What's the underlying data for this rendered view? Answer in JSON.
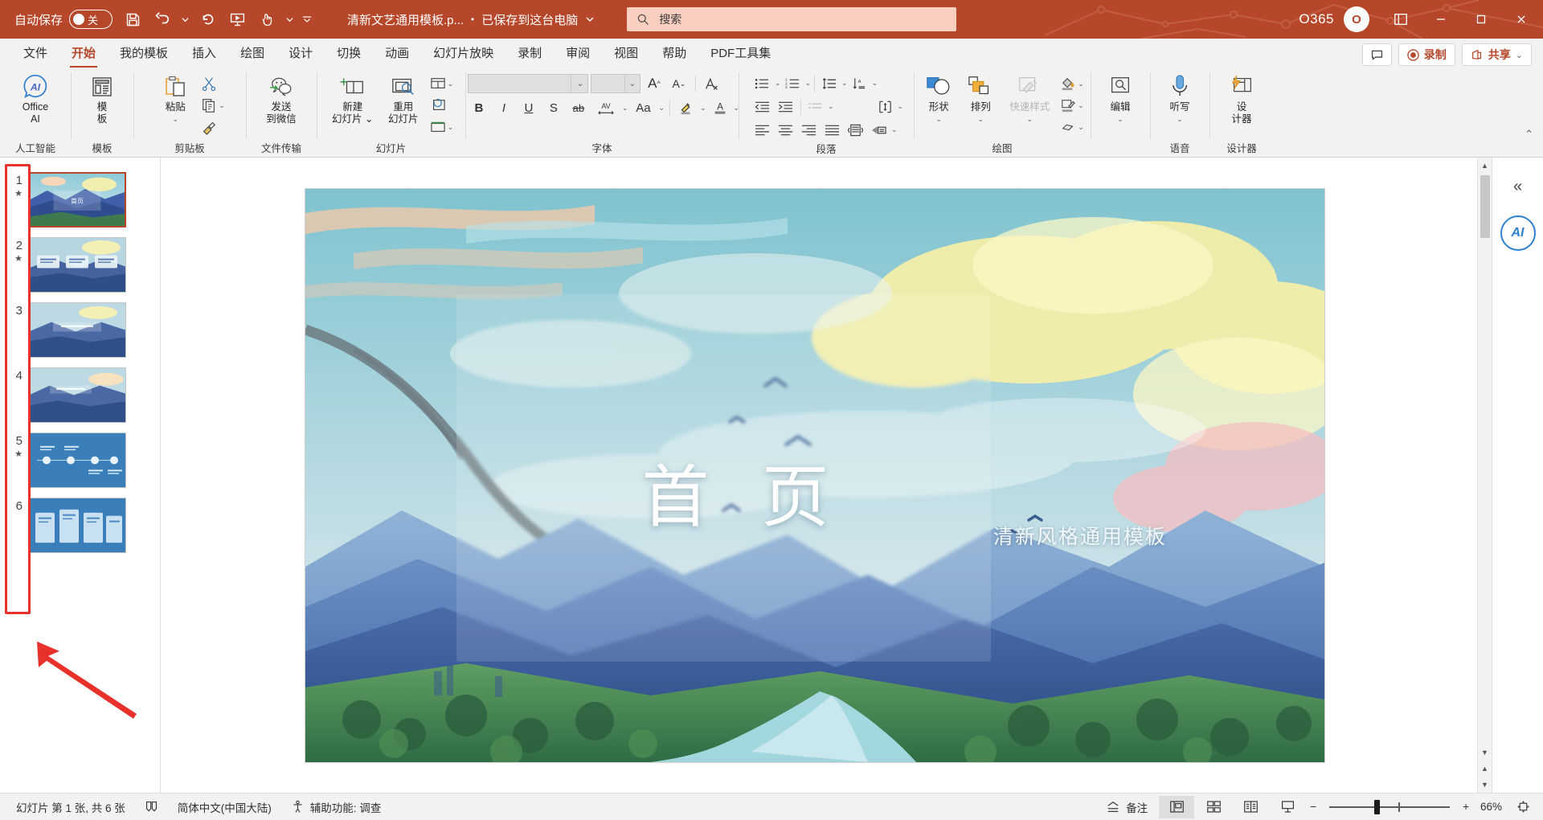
{
  "titlebar": {
    "autosave_label": "自动保存",
    "toggle_state": "关",
    "save_icon": "save-icon",
    "undo_icon": "undo-icon",
    "redo_icon": "redo-icon",
    "present_icon": "start-presentation-icon",
    "touch_icon": "touch-mode-icon",
    "customize_icon": "customize-quick-access-icon",
    "document_title": "清新文艺通用模板.p...",
    "save_state": "已保存到这台电脑",
    "separator_dot": "•",
    "account_label": "O365",
    "avatar_initial": "O",
    "minimize": "—",
    "maximize": "▢",
    "close": "✕"
  },
  "search": {
    "placeholder": "搜索",
    "icon": "search-icon"
  },
  "tabs": [
    {
      "label": "文件",
      "active": false
    },
    {
      "label": "开始",
      "active": true
    },
    {
      "label": "我的模板",
      "active": false
    },
    {
      "label": "插入",
      "active": false
    },
    {
      "label": "绘图",
      "active": false
    },
    {
      "label": "设计",
      "active": false
    },
    {
      "label": "切换",
      "active": false
    },
    {
      "label": "动画",
      "active": false
    },
    {
      "label": "幻灯片放映",
      "active": false
    },
    {
      "label": "录制",
      "active": false
    },
    {
      "label": "审阅",
      "active": false
    },
    {
      "label": "视图",
      "active": false
    },
    {
      "label": "帮助",
      "active": false
    },
    {
      "label": "PDF工具集",
      "active": false
    }
  ],
  "tabstrip_right": {
    "comment_label": "",
    "comment_icon": "comment-icon",
    "record_label": "录制",
    "record_icon": "record-dot-icon",
    "share_label": "共享",
    "share_icon": "share-icon",
    "share_chevron": "⌄"
  },
  "ribbon": {
    "groups": [
      {
        "name": "人工智能",
        "buttons": [
          {
            "label": "Office\nAI",
            "line1": "Office",
            "line2": "AI",
            "icon": "office-ai-icon"
          }
        ]
      },
      {
        "name": "模板",
        "buttons": [
          {
            "line1": "模",
            "line2": "板",
            "icon": "template-icon"
          }
        ]
      },
      {
        "name": "剪贴板",
        "has_dialog_launcher": true,
        "buttons": [
          {
            "line1": "粘贴",
            "line2": "⌄",
            "icon": "paste-icon"
          }
        ],
        "small": [
          {
            "icon": "cut-icon",
            "label": ""
          },
          {
            "icon": "copy-icon",
            "label": "",
            "chevron": "⌄"
          },
          {
            "icon": "format-painter-icon",
            "label": ""
          }
        ]
      },
      {
        "name": "文件传输",
        "buttons": [
          {
            "line1": "发送",
            "line2": "到微信",
            "icon": "wechat-icon"
          }
        ]
      },
      {
        "name": "幻灯片",
        "buttons": [
          {
            "line1": "新建",
            "line2": "幻灯片 ⌄",
            "icon": "new-slide-icon"
          },
          {
            "line1": "重用",
            "line2": "幻灯片",
            "icon": "reuse-slide-icon"
          }
        ],
        "small": [
          {
            "icon": "layout-icon",
            "chevron": "⌄"
          },
          {
            "icon": "reset-icon"
          },
          {
            "icon": "section-icon",
            "chevron": "⌄"
          }
        ]
      },
      {
        "name": "字体",
        "has_dialog_launcher": true,
        "font_name_value": "",
        "font_size_value": "",
        "row1": [
          {
            "icon": "increase-font-size-icon",
            "label": "A"
          },
          {
            "icon": "decrease-font-size-icon",
            "label": "A"
          },
          {
            "icon": "clear-formatting-icon",
            "label": "A"
          }
        ],
        "row2": [
          {
            "icon": "bold-icon",
            "label": "B"
          },
          {
            "icon": "italic-icon",
            "label": "I"
          },
          {
            "icon": "underline-icon",
            "label": "U"
          },
          {
            "icon": "text-shadow-icon",
            "label": "S"
          },
          {
            "icon": "strikethrough-icon",
            "label": "ab"
          },
          {
            "icon": "character-spacing-icon",
            "label": "AV",
            "chevron": "⌄"
          },
          {
            "icon": "change-case-icon",
            "label": "Aa",
            "chevron": "⌄"
          },
          {
            "icon": "text-highlight-icon",
            "label": "",
            "chevron": "⌄"
          },
          {
            "icon": "font-color-icon",
            "label": "A",
            "chevron": "⌄"
          }
        ]
      },
      {
        "name": "段落",
        "has_dialog_launcher": true,
        "row1": [
          {
            "icon": "bullets-icon",
            "chevron": "⌄"
          },
          {
            "icon": "numbering-icon",
            "chevron": "⌄"
          },
          {
            "icon": "line-spacing-icon",
            "chevron": "⌄"
          },
          {
            "icon": "text-direction-sort-icon",
            "chevron": "⌄"
          }
        ],
        "row2": [
          {
            "icon": "decrease-indent-icon"
          },
          {
            "icon": "increase-indent-icon"
          },
          {
            "icon": "paragraph-marks-icon",
            "chevron": "⌄"
          },
          {
            "icon": "align-text-vertical-icon",
            "chevron": "⌄"
          }
        ],
        "row3": [
          {
            "icon": "align-left-icon"
          },
          {
            "icon": "align-center-icon"
          },
          {
            "icon": "align-right-icon"
          },
          {
            "icon": "justify-icon"
          },
          {
            "icon": "columns-icon"
          },
          {
            "icon": "convert-to-smartart-icon",
            "chevron": "⌄"
          }
        ]
      },
      {
        "name": "绘图",
        "has_dialog_launcher": true,
        "buttons": [
          {
            "line1": "形状",
            "line2": "⌄",
            "icon": "shapes-icon"
          },
          {
            "line1": "排列",
            "line2": "⌄",
            "icon": "arrange-icon"
          },
          {
            "line1": "快速样式",
            "line2": "⌄",
            "icon": "quick-styles-icon",
            "disabled": true
          }
        ],
        "small": [
          {
            "icon": "shape-fill-icon",
            "chevron": "⌄"
          },
          {
            "icon": "shape-outline-icon",
            "chevron": "⌄"
          },
          {
            "icon": "shape-effects-icon",
            "chevron": "⌄"
          }
        ]
      },
      {
        "name": "",
        "buttons": [
          {
            "line1": "编辑",
            "line2": "⌄",
            "icon": "find-edit-icon"
          }
        ]
      },
      {
        "name": "语音",
        "buttons": [
          {
            "line1": "听写",
            "line2": "⌄",
            "icon": "dictate-microphone-icon"
          }
        ]
      },
      {
        "name": "设计器",
        "buttons": [
          {
            "line1": "设",
            "line2": "计器",
            "icon": "designer-icon"
          }
        ]
      }
    ],
    "collapse_icon": "collapse-ribbon-icon"
  },
  "thumbnails": {
    "slides": [
      {
        "number": "1",
        "starred": true,
        "selected": true,
        "kind": "title"
      },
      {
        "number": "2",
        "starred": true,
        "selected": false,
        "kind": "three-cards"
      },
      {
        "number": "3",
        "starred": false,
        "selected": false,
        "kind": "text-banner"
      },
      {
        "number": "4",
        "starred": false,
        "selected": false,
        "kind": "text-banner"
      },
      {
        "number": "5",
        "starred": true,
        "selected": false,
        "kind": "timeline"
      },
      {
        "number": "6",
        "starred": false,
        "selected": false,
        "kind": "columns"
      }
    ],
    "annotation_box_color": "#e8312a",
    "annotation_arrow_color": "#e8312a"
  },
  "slide": {
    "title": "首 页",
    "subtitle": "清新风格通用模板"
  },
  "rail": {
    "collapse_icon": "collapse-pane-icon",
    "collapse_glyph": "«",
    "ai_label": "AI"
  },
  "statusbar": {
    "slide_count_text": "幻灯片 第 1 张, 共 6 张",
    "notes_page_icon": "notes-page-icon",
    "language": "简体中文(中国大陆)",
    "accessibility_icon": "accessibility-icon",
    "accessibility_text": "辅助功能: 调查",
    "notes_label": "备注",
    "notes_icon": "notes-icon",
    "views": [
      {
        "icon": "normal-view-icon",
        "active": true
      },
      {
        "icon": "slide-sorter-icon",
        "active": false
      },
      {
        "icon": "reading-view-icon",
        "active": false
      },
      {
        "icon": "slideshow-view-icon",
        "active": false
      }
    ],
    "zoom_out": "−",
    "zoom_in": "+",
    "zoom_level": "66%",
    "fit_icon": "fit-to-window-icon"
  },
  "colors": {
    "brand": "#b7472a",
    "titlebar_bg": "#b7472a",
    "search_bg": "#fbcfc0",
    "ribbon_bg": "#f3f2f1",
    "annotation": "#e8312a"
  }
}
